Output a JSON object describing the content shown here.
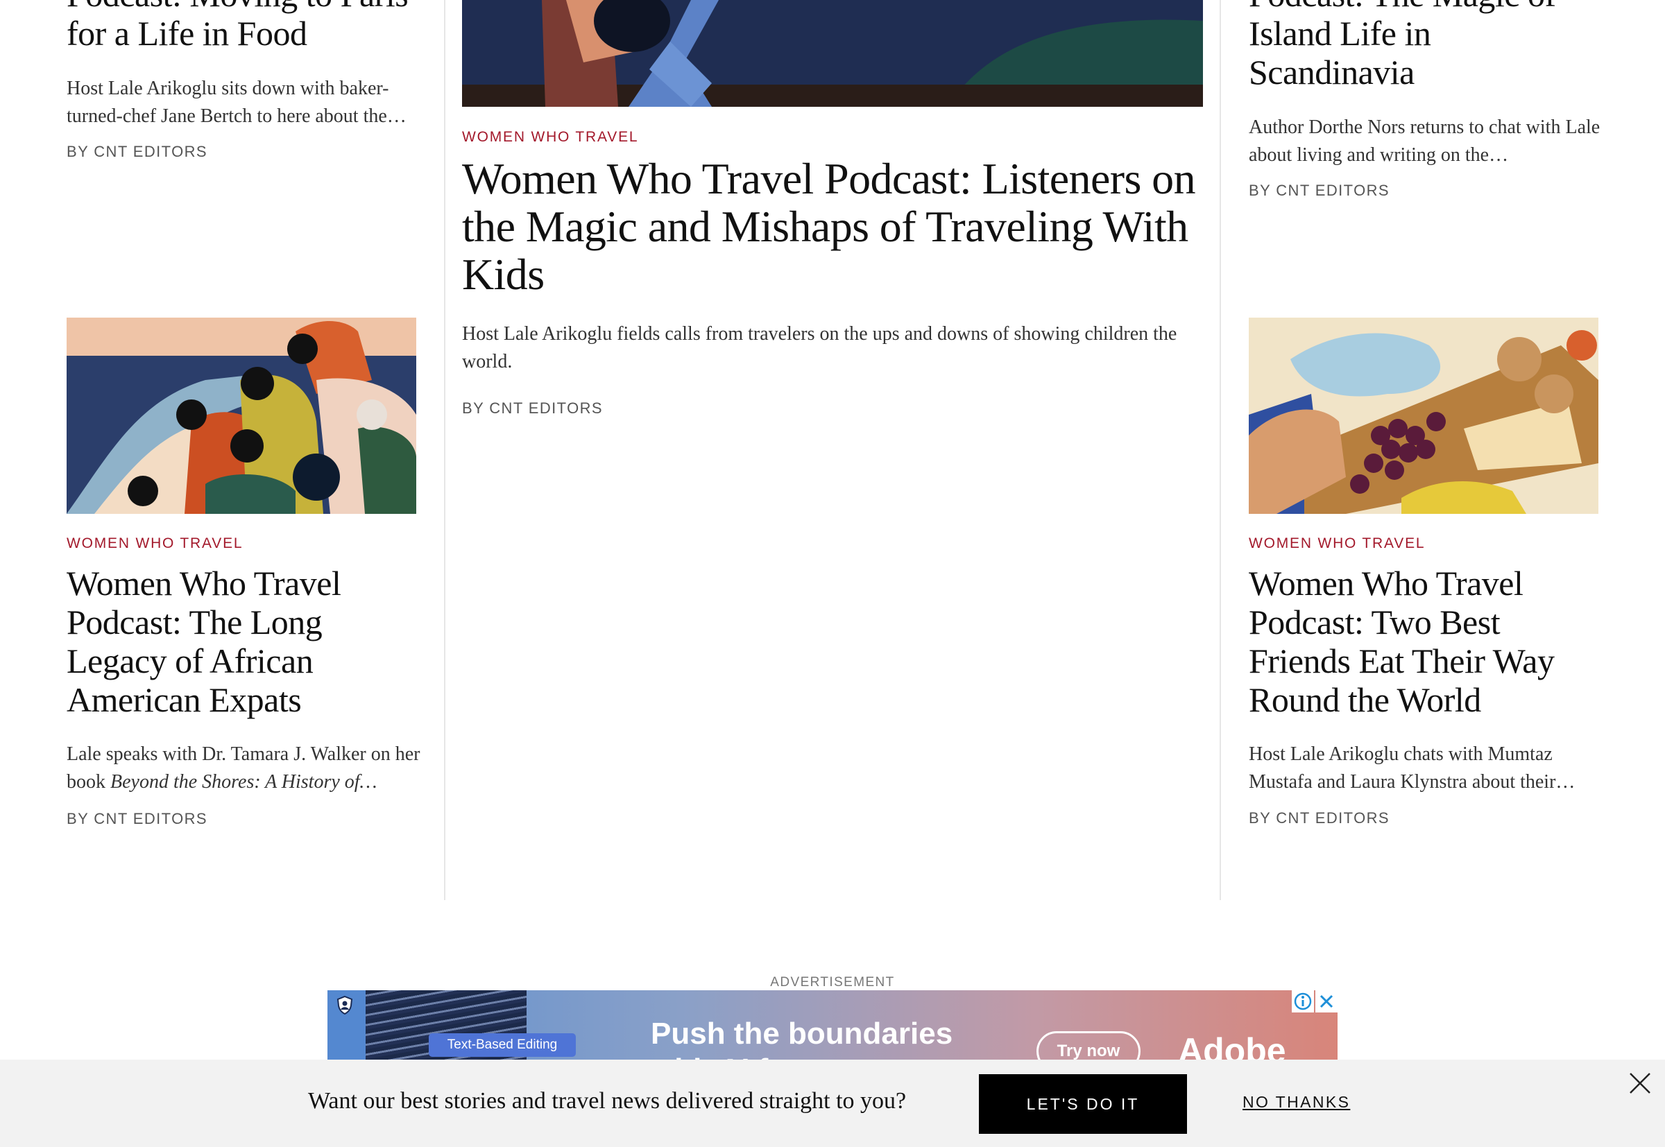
{
  "left_top_card": {
    "title": "Podcast: Moving to Paris for a Life in Food",
    "dek": "Host Lale Arikoglu sits down with baker-turned-chef Jane Bertch to here about the…",
    "byline": "BY CNT EDITORS"
  },
  "center_card": {
    "rubric": "WOMEN WHO TRAVEL",
    "title": "Women Who Travel Podcast: Listeners on the Magic and Mishaps of Traveling With Kids",
    "dek": "Host Lale Arikoglu fields calls from travelers on the ups and downs of showing children the world.",
    "byline": "BY CNT EDITORS"
  },
  "right_top_card": {
    "title": "Podcast: The Magic of Island Life in Scandinavia",
    "dek": "Author Dorthe Nors returns to chat with Lale about living and writing on the…",
    "byline": "BY CNT EDITORS"
  },
  "left_bottom_card": {
    "rubric": "WOMEN WHO TRAVEL",
    "title": "Women Who Travel Podcast: The Long Legacy of African American Expats",
    "dek_prefix": "Lale speaks with Dr. Tamara J. Walker on her book ",
    "dek_italic": "Beyond the Shores: A History of…",
    "byline": "BY CNT EDITORS"
  },
  "right_bottom_card": {
    "rubric": "WOMEN WHO TRAVEL",
    "title": "Women Who Travel Podcast: Two Best Friends Eat Their Way Round the World",
    "dek": "Host Lale Arikoglu chats with Mumtaz Mustafa and Laura Klynstra about their…",
    "byline": "BY CNT EDITORS"
  },
  "advertisement": {
    "label": "ADVERTISEMENT",
    "badge": "Text-Based Editing",
    "headline": "Push the boundaries",
    "headline_partial": "with AI f",
    "cta": "Try now",
    "brand": "Adobe",
    "info_icon": "info-icon",
    "close_icon": "close-icon"
  },
  "newsletter_banner": {
    "prompt": "Want our best stories and travel news delivered straight to you?",
    "accept_label": "LET'S DO IT",
    "decline_label": "NO THANKS",
    "close_icon": "close-icon"
  },
  "colors": {
    "rubric": "#a3192b",
    "banner_bg": "#f2f2f2",
    "cta_bg": "#000000"
  }
}
